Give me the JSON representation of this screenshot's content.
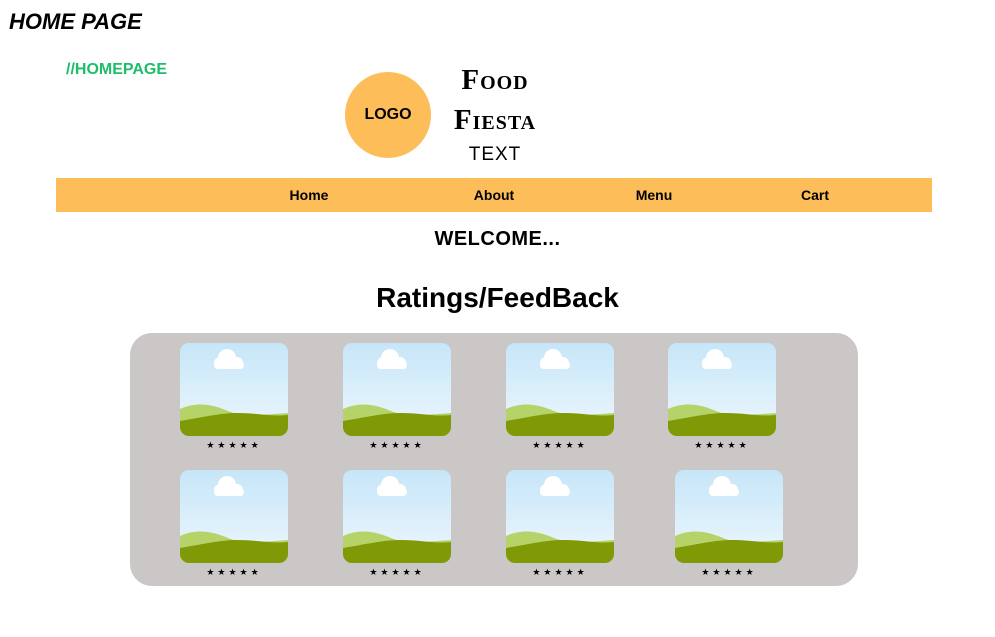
{
  "page_label": "HOME PAGE",
  "comment": "//HOMEPAGE",
  "logo": {
    "text": "LOGO",
    "color": "#fdbd59"
  },
  "brand": {
    "line1": "Food",
    "line2": "Fiesta",
    "subtitle": "TEXT"
  },
  "nav": {
    "color": "#fdbd59",
    "items": [
      {
        "label": "Home"
      },
      {
        "label": "About"
      },
      {
        "label": "Menu"
      },
      {
        "label": "Cart"
      }
    ]
  },
  "welcome": "WELCOME...",
  "section_title": "Ratings/FeedBack",
  "feedback": {
    "panel_color": "#cbc7c7",
    "cards": [
      {
        "image_icon": "landscape-placeholder-icon",
        "rating": "★★★★★"
      },
      {
        "image_icon": "landscape-placeholder-icon",
        "rating": "★★★★★"
      },
      {
        "image_icon": "landscape-placeholder-icon",
        "rating": "★★★★★"
      },
      {
        "image_icon": "landscape-placeholder-icon",
        "rating": "★★★★★"
      },
      {
        "image_icon": "landscape-placeholder-icon",
        "rating": "★★★★★"
      },
      {
        "image_icon": "landscape-placeholder-icon",
        "rating": "★★★★★"
      },
      {
        "image_icon": "landscape-placeholder-icon",
        "rating": "★★★★★"
      },
      {
        "image_icon": "landscape-placeholder-icon",
        "rating": "★★★★★"
      }
    ]
  }
}
